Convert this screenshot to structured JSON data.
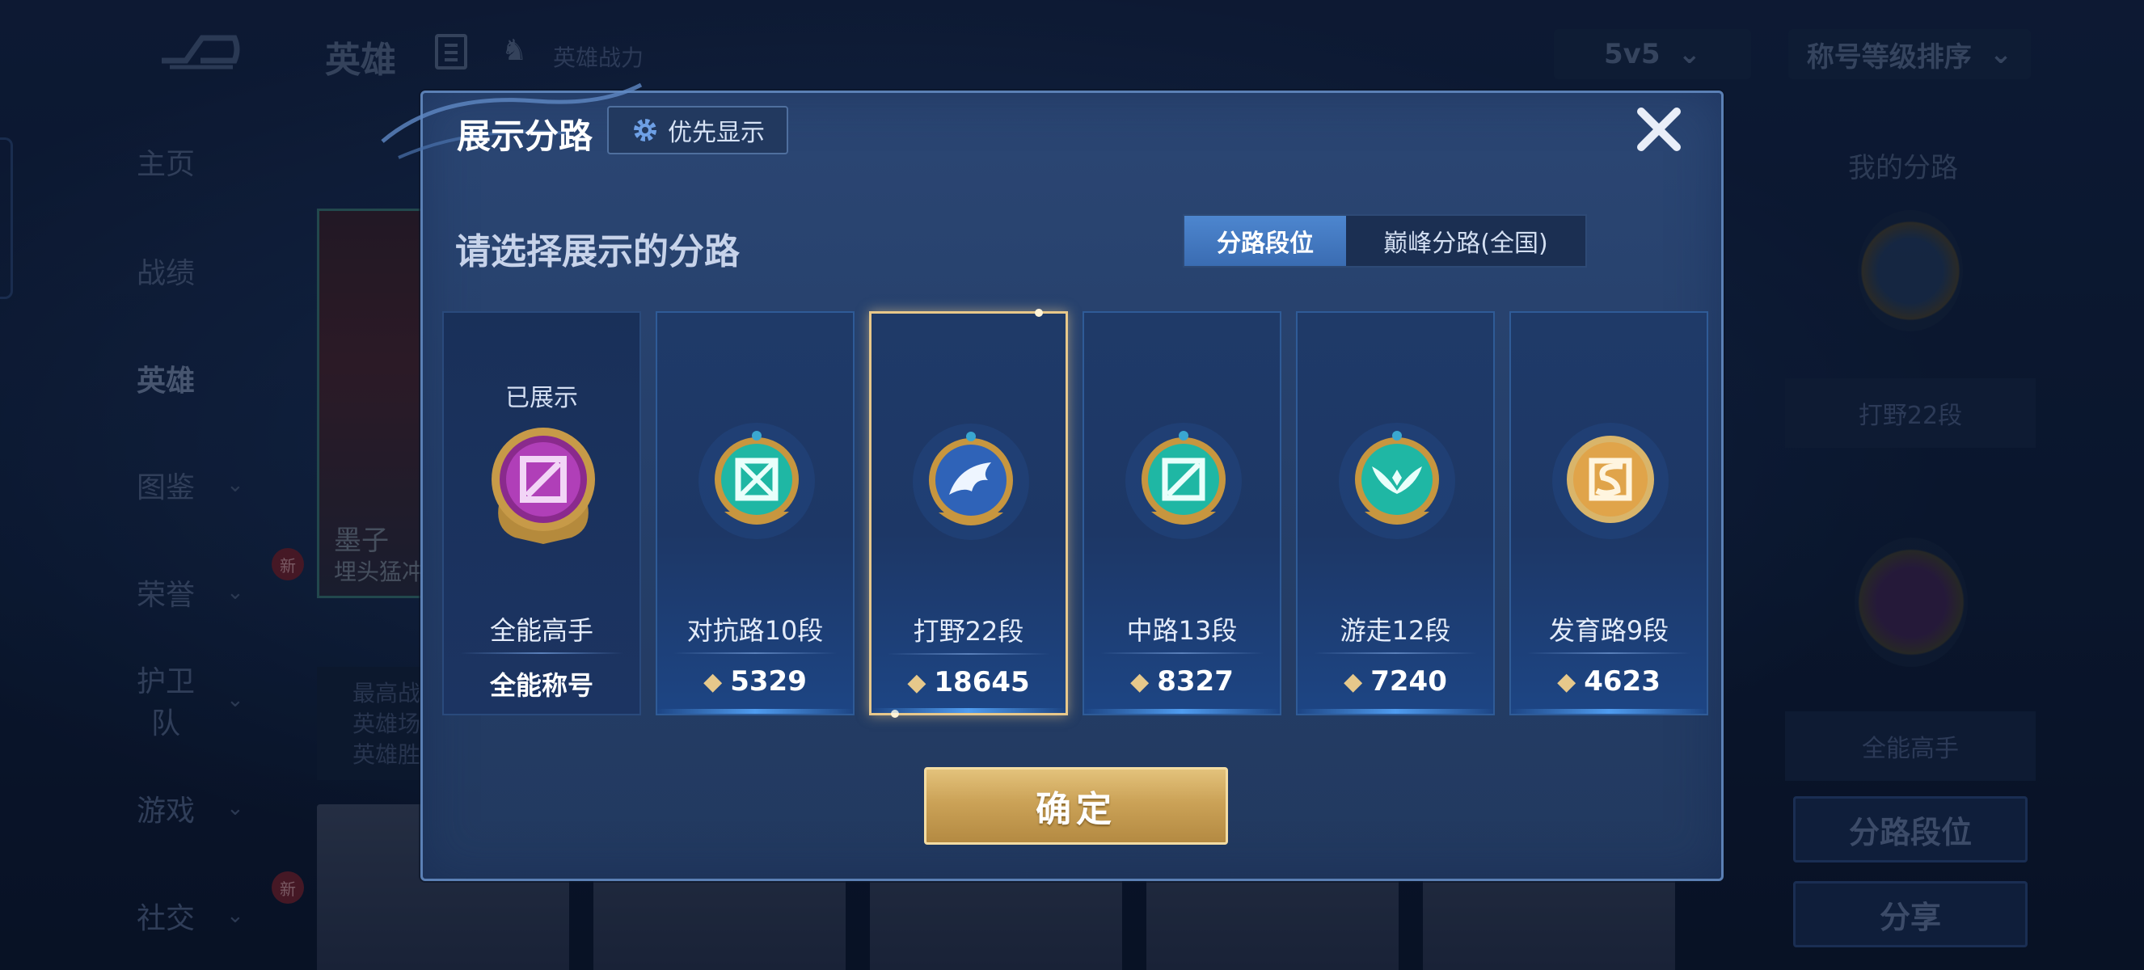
{
  "background": {
    "top_title": "英雄",
    "power_label": "英雄战力",
    "mode_select": "5v5",
    "sort_select": "称号等级排序",
    "nav": [
      {
        "label": "主页",
        "chevron": false,
        "badge": ""
      },
      {
        "label": "战绩",
        "chevron": false,
        "badge": ""
      },
      {
        "label": "英雄",
        "chevron": false,
        "badge": "",
        "active": true
      },
      {
        "label": "图鉴",
        "chevron": true,
        "badge": ""
      },
      {
        "label": "荣誉",
        "chevron": true,
        "badge": "新"
      },
      {
        "label": "护卫队",
        "chevron": true,
        "badge": ""
      },
      {
        "label": "游戏",
        "chevron": true,
        "badge": ""
      },
      {
        "label": "社交",
        "chevron": true,
        "badge": "新"
      }
    ],
    "hero_card": {
      "name": "墨子",
      "subtitle": "埋头猛冲"
    },
    "hero_stats": [
      "最高战",
      "英雄场",
      "英雄胜"
    ],
    "right_panel": {
      "title": "我的分路",
      "lane_box": "打野22段",
      "title_box": "全能高手",
      "btn_lane_rank": "分路段位",
      "btn_share": "分享"
    }
  },
  "dialog": {
    "title": "展示分路",
    "priority_button": "优先显示",
    "prompt": "请选择展示的分路",
    "tabs": [
      {
        "label": "分路段位",
        "active": true
      },
      {
        "label": "巅峰分路(全国)",
        "active": false
      }
    ],
    "cards": [
      {
        "shown_label": "已展示",
        "lane": "全能高手",
        "value": "全能称号",
        "kind": "title",
        "medal": "purple-medal-icon",
        "color": "#b03fb8"
      },
      {
        "shown_label": "",
        "lane": "对抗路10段",
        "value": "5329",
        "kind": "score",
        "medal": "clash-lane-medal-icon",
        "color": "#1fb7a4"
      },
      {
        "shown_label": "",
        "lane": "打野22段",
        "value": "18645",
        "kind": "score",
        "medal": "jungle-dragon-medal-icon",
        "color": "#2f63b8",
        "selected": true
      },
      {
        "shown_label": "",
        "lane": "中路13段",
        "value": "8327",
        "kind": "score",
        "medal": "mid-lane-medal-icon",
        "color": "#1fb7a4"
      },
      {
        "shown_label": "",
        "lane": "游走12段",
        "value": "7240",
        "kind": "score",
        "medal": "roam-wings-medal-icon",
        "color": "#1fb7a4"
      },
      {
        "shown_label": "",
        "lane": "发育路9段",
        "value": "4623",
        "kind": "score",
        "medal": "farm-lane-medal-icon",
        "color": "#e0a44a"
      }
    ],
    "confirm_button": "确定"
  },
  "colors": {
    "accent_gold": "#e3c27b",
    "tab_active": "#4d86cf",
    "dialog_bg": "#253f6a"
  }
}
